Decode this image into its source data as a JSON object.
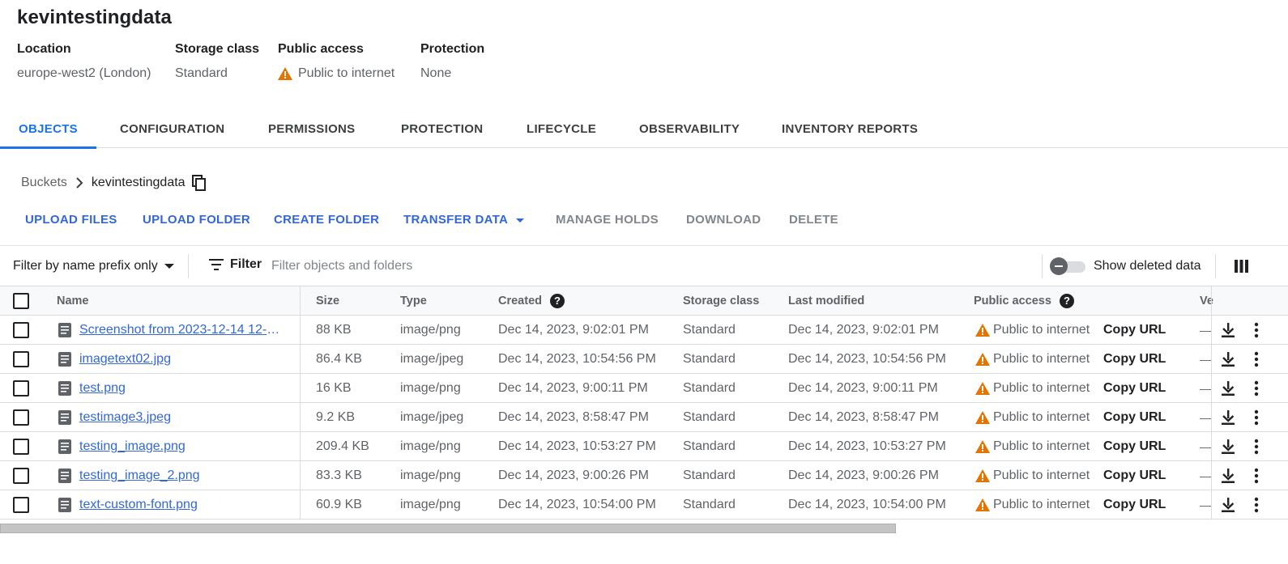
{
  "bucket": {
    "name": "kevintestingdata",
    "meta": [
      {
        "label": "Location",
        "value": "europe-west2 (London)"
      },
      {
        "label": "Storage class",
        "value": "Standard"
      },
      {
        "label": "Public access",
        "value": "Public to internet"
      },
      {
        "label": "Protection",
        "value": "None"
      }
    ]
  },
  "tabs": [
    "OBJECTS",
    "CONFIGURATION",
    "PERMISSIONS",
    "PROTECTION",
    "LIFECYCLE",
    "OBSERVABILITY",
    "INVENTORY REPORTS"
  ],
  "active_tab": "OBJECTS",
  "breadcrumb": {
    "root": "Buckets",
    "current": "kevintestingdata"
  },
  "actions": {
    "upload_files": "UPLOAD FILES",
    "upload_folder": "UPLOAD FOLDER",
    "create_folder": "CREATE FOLDER",
    "transfer_data": "TRANSFER DATA",
    "manage_holds": "MANAGE HOLDS",
    "download": "DOWNLOAD",
    "delete": "DELETE"
  },
  "filter": {
    "prefix_label": "Filter by name prefix only",
    "filter_label": "Filter",
    "placeholder": "Filter objects and folders",
    "show_deleted": "Show deleted data",
    "show_deleted_on": false
  },
  "table": {
    "headers": {
      "name": "Name",
      "size": "Size",
      "type": "Type",
      "created": "Created",
      "storage_class": "Storage class",
      "last_modified": "Last modified",
      "public_access": "Public access",
      "version": "Ve"
    },
    "rows": [
      {
        "name": "Screenshot from 2023-12-14 12-5…",
        "size": "88 KB",
        "type": "image/png",
        "created": "Dec 14, 2023, 9:02:01 PM",
        "storage_class": "Standard",
        "last_modified": "Dec 14, 2023, 9:02:01 PM",
        "public_access": "Public to internet",
        "copy_url": "Copy URL",
        "version": "—"
      },
      {
        "name": "imagetext02.jpg",
        "size": "86.4 KB",
        "type": "image/jpeg",
        "created": "Dec 14, 2023, 10:54:56 PM",
        "storage_class": "Standard",
        "last_modified": "Dec 14, 2023, 10:54:56 PM",
        "public_access": "Public to internet",
        "copy_url": "Copy URL",
        "version": "—"
      },
      {
        "name": "test.png",
        "size": "16 KB",
        "type": "image/png",
        "created": "Dec 14, 2023, 9:00:11 PM",
        "storage_class": "Standard",
        "last_modified": "Dec 14, 2023, 9:00:11 PM",
        "public_access": "Public to internet",
        "copy_url": "Copy URL",
        "version": "—"
      },
      {
        "name": "testimage3.jpeg",
        "size": "9.2 KB",
        "type": "image/jpeg",
        "created": "Dec 14, 2023, 8:58:47 PM",
        "storage_class": "Standard",
        "last_modified": "Dec 14, 2023, 8:58:47 PM",
        "public_access": "Public to internet",
        "copy_url": "Copy URL",
        "version": "—"
      },
      {
        "name": "testing_image.png",
        "size": "209.4 KB",
        "type": "image/png",
        "created": "Dec 14, 2023, 10:53:27 PM",
        "storage_class": "Standard",
        "last_modified": "Dec 14, 2023, 10:53:27 PM",
        "public_access": "Public to internet",
        "copy_url": "Copy URL",
        "version": "—"
      },
      {
        "name": "testing_image_2.png",
        "size": "83.3 KB",
        "type": "image/png",
        "created": "Dec 14, 2023, 9:00:26 PM",
        "storage_class": "Standard",
        "last_modified": "Dec 14, 2023, 9:00:26 PM",
        "public_access": "Public to internet",
        "copy_url": "Copy URL",
        "version": "—"
      },
      {
        "name": "text-custom-font.png",
        "size": "60.9 KB",
        "type": "image/png",
        "created": "Dec 14, 2023, 10:54:00 PM",
        "storage_class": "Standard",
        "last_modified": "Dec 14, 2023, 10:54:00 PM",
        "public_access": "Public to internet",
        "copy_url": "Copy URL",
        "version": "—"
      }
    ]
  },
  "colors": {
    "accent": "#1a73e8",
    "link": "#3367d6",
    "warning": "#e37400"
  }
}
